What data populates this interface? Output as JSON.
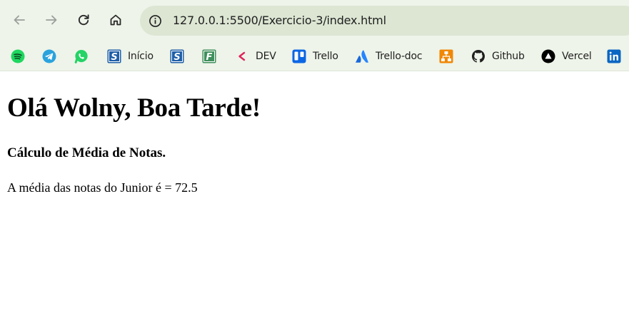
{
  "browser": {
    "url": "127.0.0.1:5500/Exercicio-3/index.html",
    "bookmarks": [
      {
        "icon": "spotify-icon",
        "label": ""
      },
      {
        "icon": "telegram-icon",
        "label": ""
      },
      {
        "icon": "whatsapp-icon",
        "label": ""
      },
      {
        "icon": "s-logo-icon",
        "label": "Início"
      },
      {
        "icon": "s-logo-icon",
        "label": ""
      },
      {
        "icon": "f-logo-icon",
        "label": ""
      },
      {
        "icon": "dev-chevron-icon",
        "label": "DEV"
      },
      {
        "icon": "trello-icon",
        "label": "Trello"
      },
      {
        "icon": "atlassian-icon",
        "label": "Trello-doc"
      },
      {
        "icon": "diagram-icon",
        "label": ""
      },
      {
        "icon": "github-icon",
        "label": "Github"
      },
      {
        "icon": "vercel-icon",
        "label": "Vercel"
      },
      {
        "icon": "linkedin-icon",
        "label": ""
      }
    ]
  },
  "colors": {
    "chrome_background": "#eef4e9",
    "omnibox_background": "#dce6d3"
  },
  "page": {
    "heading": "Olá Wolny, Boa Tarde!",
    "subheading": "Cálculo de Média de Notas.",
    "result": "A média das notas do Junior é = 72.5"
  }
}
